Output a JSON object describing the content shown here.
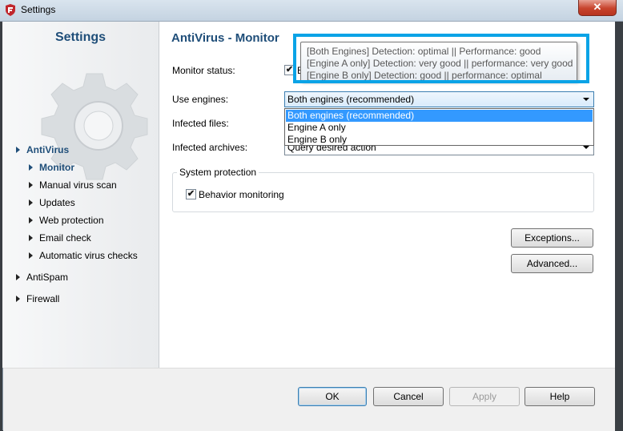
{
  "window": {
    "title": "Settings",
    "close_label": "✕"
  },
  "sidebar": {
    "title": "Settings",
    "items": [
      {
        "label": "AntiVirus"
      },
      {
        "label": "Monitor"
      },
      {
        "label": "Manual virus scan"
      },
      {
        "label": "Updates"
      },
      {
        "label": "Web protection"
      },
      {
        "label": "Email check"
      },
      {
        "label": "Automatic virus checks"
      },
      {
        "label": "AntiSpam"
      },
      {
        "label": "Firewall"
      }
    ]
  },
  "main": {
    "title": "AntiVirus - Monitor",
    "monitor_status": {
      "label": "Monitor status:",
      "checked": true,
      "value_partial": "E"
    },
    "use_engines": {
      "label": "Use engines:",
      "value": "Both engines (recommended)",
      "options": [
        "Both engines (recommended)",
        "Engine A only",
        "Engine B only"
      ]
    },
    "infected_files": {
      "label": "Infected files:"
    },
    "infected_archives": {
      "label": "Infected archives:",
      "value": "Query desired action"
    },
    "system_protection": {
      "label": "System protection",
      "behavior_monitoring": {
        "label": "Behavior monitoring",
        "checked": true
      }
    },
    "buttons": {
      "exceptions": "Exceptions...",
      "advanced": "Advanced..."
    }
  },
  "tooltip": {
    "lines": [
      "[Both Engines] Detection: optimal || Performance: good",
      "[Engine A only] Detection: very good || performance: very good",
      "[Engine B only] Detection: good || performance: optimal"
    ]
  },
  "footer": {
    "ok": "OK",
    "cancel": "Cancel",
    "apply": "Apply",
    "help": "Help"
  },
  "icons": {
    "app": "shield-icon",
    "check": "✔"
  },
  "colors": {
    "accent": "#1f4e79",
    "highlight": "#0aa3e6",
    "selection": "#3399ff",
    "close": "#c7432c"
  }
}
